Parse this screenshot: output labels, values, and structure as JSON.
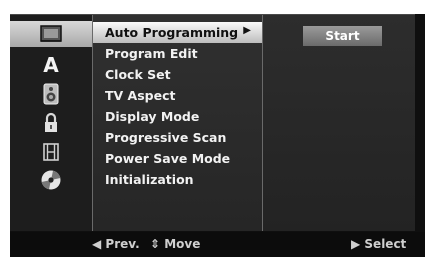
{
  "menu": {
    "items": [
      {
        "label": "Auto Programming"
      },
      {
        "label": "Program Edit"
      },
      {
        "label": "Clock Set"
      },
      {
        "label": "TV Aspect"
      },
      {
        "label": "Display Mode"
      },
      {
        "label": "Progressive Scan"
      },
      {
        "label": "Power Save Mode"
      },
      {
        "label": "Initialization"
      }
    ],
    "selected_index": 0,
    "submenu_arrow": "▶"
  },
  "right_panel": {
    "start_label": "Start"
  },
  "sidebar": {
    "icons": [
      {
        "name": "setup-screen-icon",
        "selected": true
      },
      {
        "name": "language-a-icon",
        "glyph": "A"
      },
      {
        "name": "speaker-audio-icon"
      },
      {
        "name": "padlock-icon"
      },
      {
        "name": "film-recording-icon"
      },
      {
        "name": "disc-icon"
      }
    ]
  },
  "footer": {
    "prev": "◀ Prev.",
    "move": "⇕ Move",
    "select": "▶ Select"
  },
  "colors": {
    "selected_bg": "#e0e0e0",
    "panel_bg": "#2a2a2a",
    "text": "#f2f2f2"
  }
}
